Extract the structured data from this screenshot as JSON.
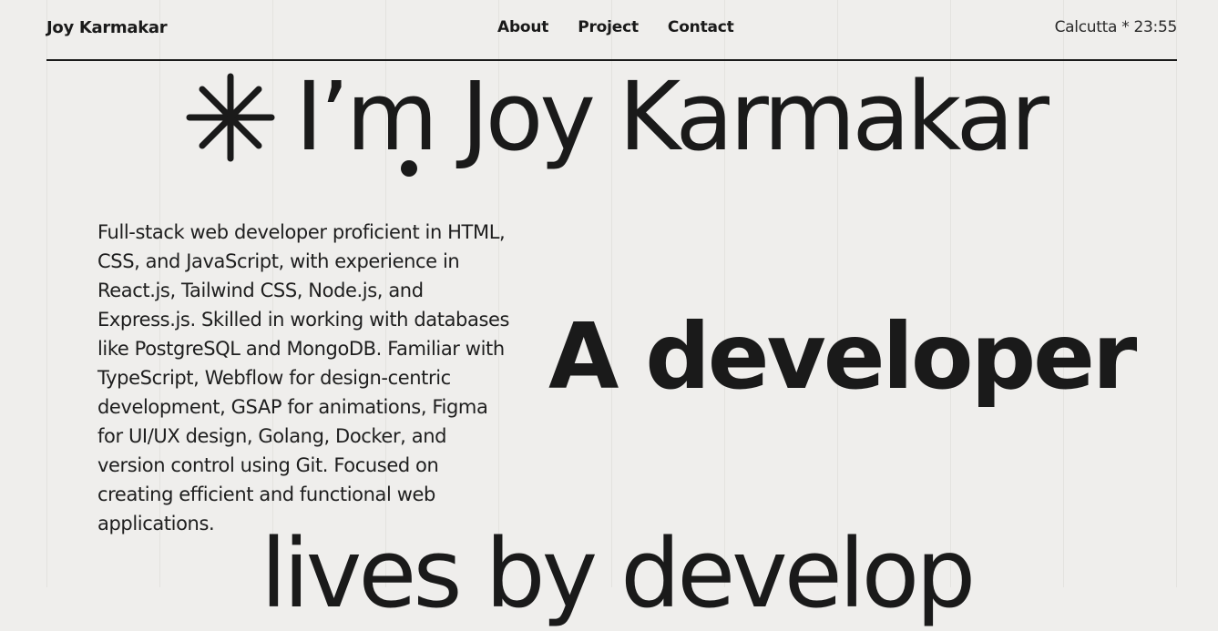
{
  "header": {
    "logo": "Joy Karmakar",
    "nav": [
      {
        "label": "About"
      },
      {
        "label": "Project"
      },
      {
        "label": "Contact"
      }
    ],
    "clock": "Calcutta * 23:55"
  },
  "hero": {
    "title": "I’m Joy Karmakar",
    "bio": "Full-stack web developer proficient in HTML, CSS, and JavaScript, with experience in React.js, Tailwind CSS, Node.js, and Express.js. Skilled in working with databases like PostgreSQL and MongoDB. Familiar with TypeScript, Webflow for design-centric development, GSAP for animations, Figma for UI/UX design, Golang, Docker, and version control using Git. Focused on creating efficient and functional web applications.",
    "role": "A developer",
    "tagline": "lives by develop"
  },
  "icons": {
    "hero_mark": "asterisk-icon"
  },
  "colors": {
    "background": "#efeeec",
    "text": "#1a1a1a"
  }
}
